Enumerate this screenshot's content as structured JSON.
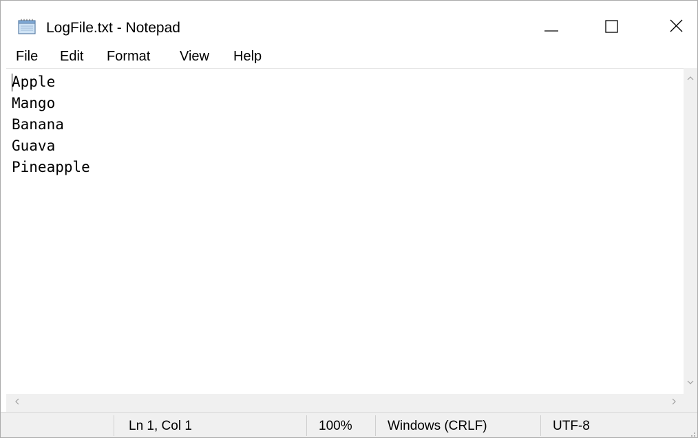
{
  "window": {
    "title": "LogFile.txt - Notepad",
    "icon": "notepad-icon",
    "controls": {
      "minimize": "minimize-icon",
      "maximize": "maximize-icon",
      "close": "close-icon"
    }
  },
  "menu": {
    "items": [
      {
        "label": "File"
      },
      {
        "label": "Edit"
      },
      {
        "label": "Format"
      },
      {
        "label": "View"
      },
      {
        "label": "Help"
      }
    ]
  },
  "editor": {
    "lines": [
      "Apple",
      "Mango",
      "Banana",
      "Guava",
      "Pineapple"
    ]
  },
  "status": {
    "position": "Ln 1, Col 1",
    "zoom": "100%",
    "line_ending": "Windows (CRLF)",
    "encoding": "UTF-8"
  },
  "colors": {
    "background": "#ffffff",
    "chrome": "#f0f0f0",
    "text": "#000000"
  }
}
